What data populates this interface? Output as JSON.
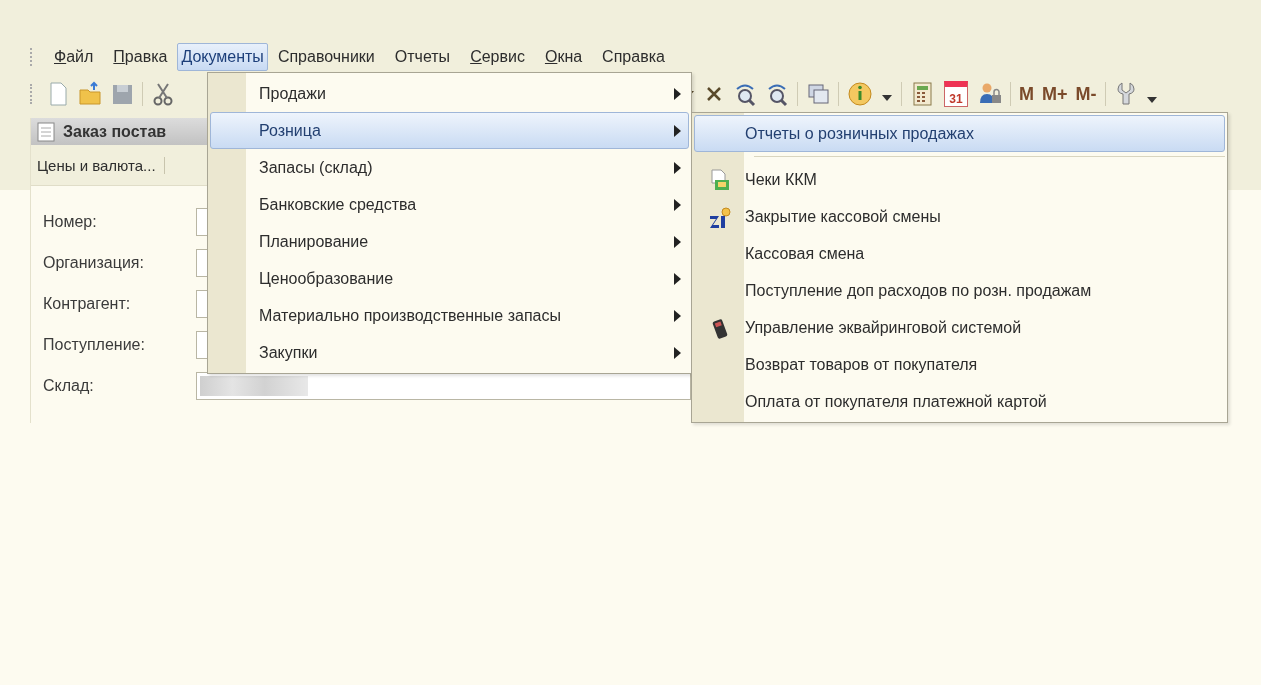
{
  "menubar": [
    {
      "label": "Файл",
      "mnemonic": true,
      "selected": false
    },
    {
      "label": "Правка",
      "mnemonic": true,
      "selected": false
    },
    {
      "label": "Документы",
      "mnemonic": false,
      "selected": true
    },
    {
      "label": "Справочники",
      "mnemonic": false,
      "selected": false
    },
    {
      "label": "Отчеты",
      "mnemonic": false,
      "selected": false
    },
    {
      "label": "Сервис",
      "mnemonic": true,
      "selected": false
    },
    {
      "label": "Окна",
      "mnemonic": true,
      "selected": false
    },
    {
      "label": "Справка",
      "mnemonic": false,
      "selected": false
    }
  ],
  "toolbar": {
    "calendar_day": "31",
    "memory_buttons": [
      "M",
      "M+",
      "M-"
    ]
  },
  "document": {
    "title": "Заказ постав",
    "command_bar": [
      "Цены и валюта..."
    ],
    "fields": [
      {
        "label": "Номер:"
      },
      {
        "label": "Организация:"
      },
      {
        "label": "Контрагент:"
      },
      {
        "label": "Поступление:"
      },
      {
        "label": "Склад:"
      }
    ]
  },
  "documents_menu": [
    {
      "label": "Продажи",
      "selected": false
    },
    {
      "label": "Розница",
      "selected": true
    },
    {
      "label": "Запасы (склад)",
      "selected": false
    },
    {
      "label": "Банковские средства",
      "selected": false
    },
    {
      "label": "Планирование",
      "selected": false
    },
    {
      "label": "Ценообразование",
      "selected": false
    },
    {
      "label": "Материально производственные запасы",
      "selected": false
    },
    {
      "label": "Закупки",
      "selected": false
    }
  ],
  "retail_menu": [
    {
      "label": "Отчеты о розничных продажах",
      "selected": true,
      "kind": "plain",
      "separator_after": true
    },
    {
      "label": "Чеки ККМ",
      "selected": false,
      "kind": "receipt",
      "separator_after": false
    },
    {
      "label": "Закрытие кассовой смены",
      "selected": false,
      "kind": "closing",
      "separator_after": false
    },
    {
      "label": "Кассовая смена",
      "selected": false,
      "kind": "plain",
      "separator_after": false
    },
    {
      "label": "Поступление доп расходов по розн. продажам",
      "selected": false,
      "kind": "plain",
      "separator_after": false
    },
    {
      "label": "Управление эквайринговой системой",
      "selected": false,
      "kind": "terminal",
      "separator_after": false
    },
    {
      "label": "Возврат товаров от покупателя",
      "selected": false,
      "kind": "plain",
      "separator_after": false
    },
    {
      "label": "Оплата от покупателя платежной картой",
      "selected": false,
      "kind": "plain",
      "separator_after": false
    }
  ]
}
